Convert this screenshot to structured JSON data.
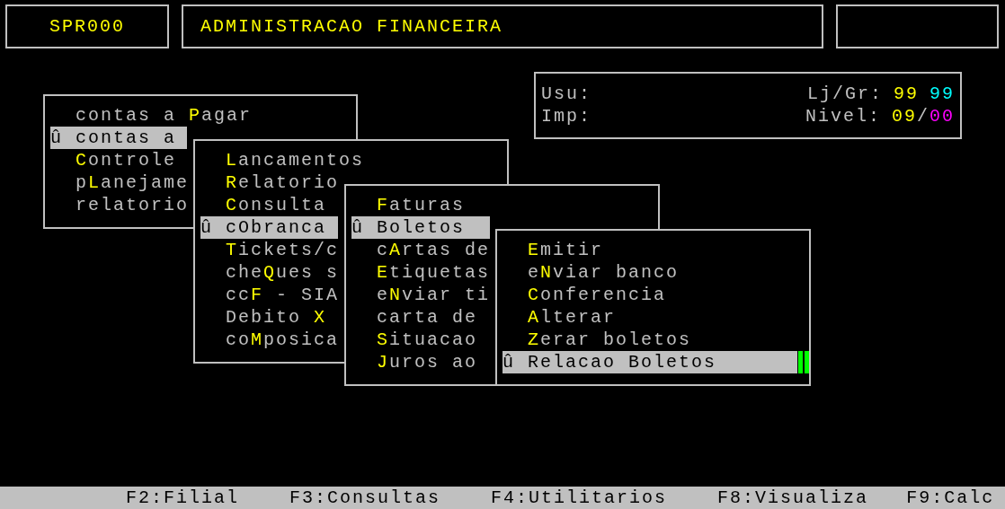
{
  "header": {
    "program_code": "SPR000",
    "title": "ADMINISTRACAO FINANCEIRA"
  },
  "session": {
    "user_label": "Usu:",
    "printer_label": "Imp:",
    "store_group_label": "Lj/Gr:",
    "store": "99",
    "group": "99",
    "level_label": "Nivel:",
    "level_value": "09",
    "level_separator": "/",
    "level_max": "00"
  },
  "menus": [
    {
      "items": [
        {
          "text": "contas a **P**agar",
          "selected": false
        },
        {
          "marker": "û",
          "text": "contas a",
          "selected": true
        },
        {
          "text": "**C**ontrole",
          "selected": false
        },
        {
          "text": "p**L**anejame",
          "selected": false
        },
        {
          "text": "relatorio",
          "selected": false
        }
      ]
    },
    {
      "items": [
        {
          "text": "**L**ancamentos",
          "selected": false
        },
        {
          "text": "**R**elatorio",
          "selected": false
        },
        {
          "text": "**C**onsulta",
          "selected": false
        },
        {
          "marker": "û",
          "text": "cObranca",
          "selected": true
        },
        {
          "text": "**T**ickets/c",
          "selected": false
        },
        {
          "text": "che**Q**ues s",
          "selected": false
        },
        {
          "text": "cc**F** - SIA",
          "selected": false
        },
        {
          "text": "Debito **X**",
          "selected": false
        },
        {
          "text": "co**M**posica",
          "selected": false
        }
      ]
    },
    {
      "items": [
        {
          "text": "**F**aturas",
          "selected": false
        },
        {
          "marker": "û",
          "text": "Boletos",
          "selected": true
        },
        {
          "text": "c**A**rtas de",
          "selected": false
        },
        {
          "text": "**E**tiquetas",
          "selected": false
        },
        {
          "text": "e**N**viar ti",
          "selected": false
        },
        {
          "text": "carta de",
          "selected": false
        },
        {
          "text": "**S**ituacao",
          "selected": false
        },
        {
          "text": "**J**uros ao",
          "selected": false
        }
      ]
    },
    {
      "items": [
        {
          "text": "**E**mitir",
          "selected": false
        },
        {
          "text": "e**N**viar banco",
          "selected": false
        },
        {
          "text": "**C**onferencia",
          "selected": false
        },
        {
          "text": "**A**lterar",
          "selected": false
        },
        {
          "text": "**Z**erar boletos",
          "selected": false
        },
        {
          "marker": "û",
          "text": "Relacao Boletos",
          "selected": true
        }
      ]
    }
  ],
  "function_keys": [
    "F2:Filial",
    "F3:Consultas",
    "F4:Utilitarios",
    "F8:Visualiza",
    "F9:Calc"
  ]
}
